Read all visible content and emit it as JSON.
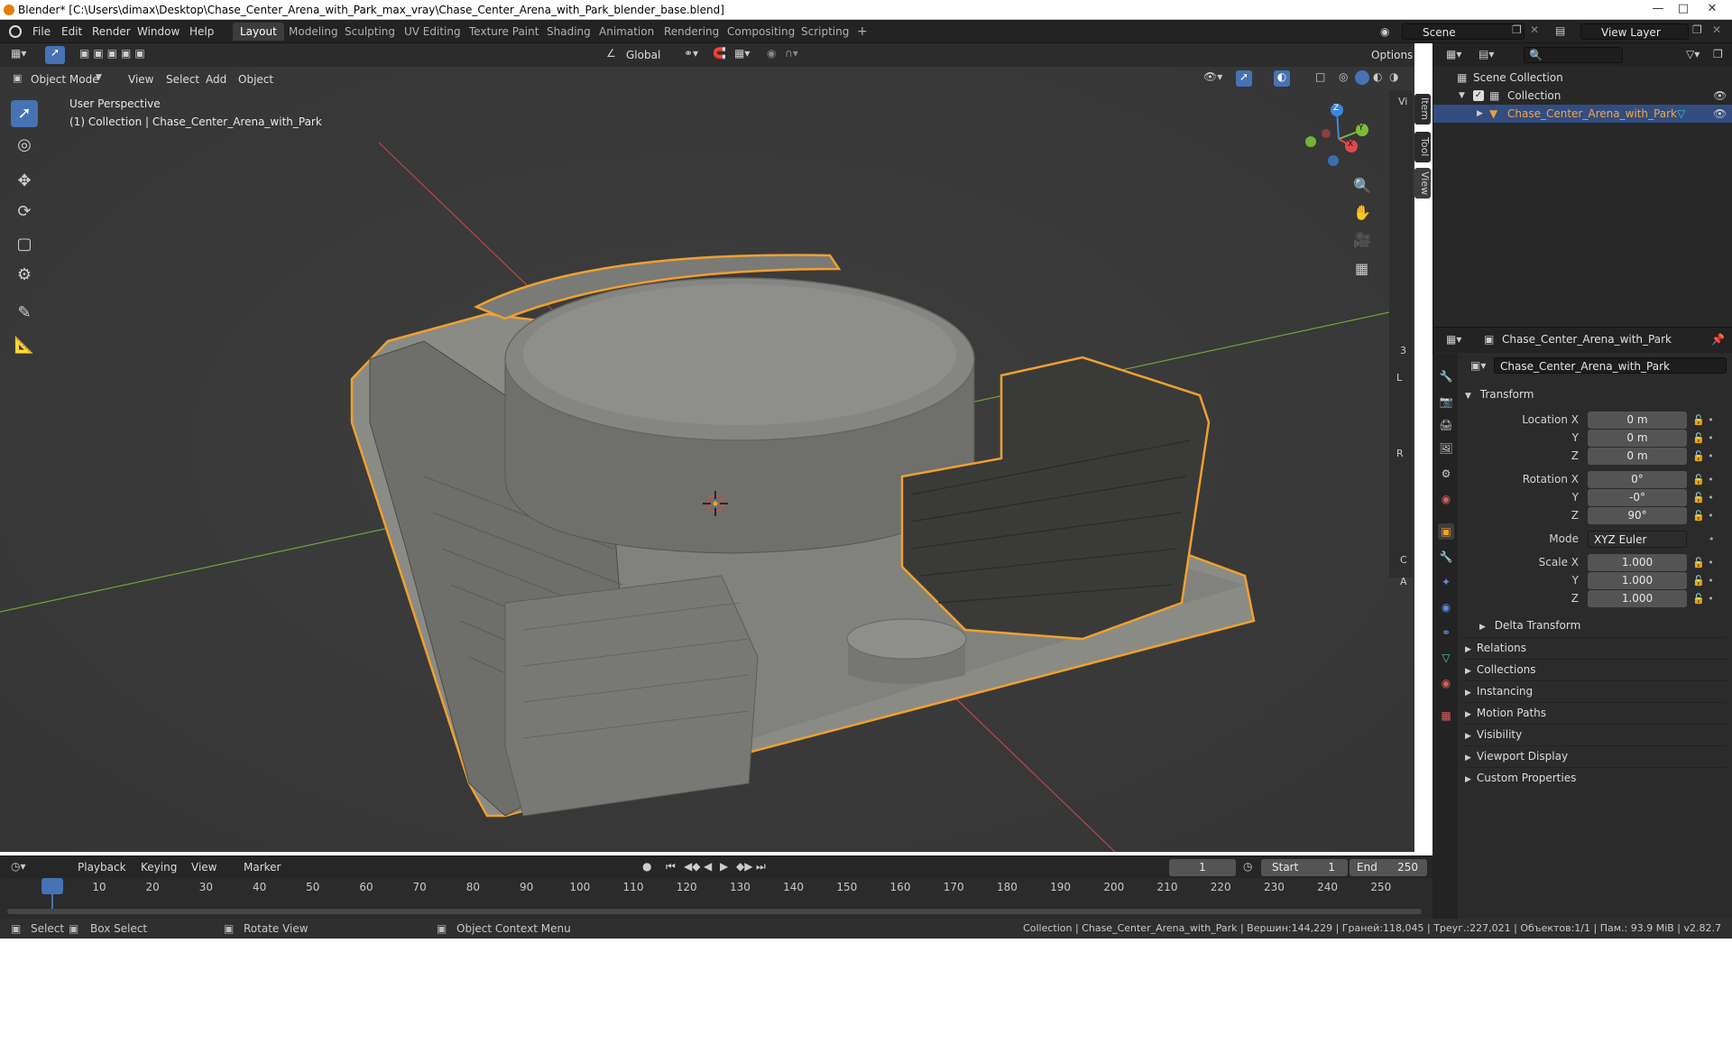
{
  "window": {
    "title": "Blender* [C:\\Users\\dimax\\Desktop\\Chase_Center_Arena_with_Park_max_vray\\Chase_Center_Arena_with_Park_blender_base.blend]"
  },
  "menu": [
    "File",
    "Edit",
    "Render",
    "Window",
    "Help"
  ],
  "workspaces": [
    "Layout",
    "Modeling",
    "Sculpting",
    "UV Editing",
    "Texture Paint",
    "Shading",
    "Animation",
    "Rendering",
    "Compositing",
    "Scripting"
  ],
  "active_workspace": "Layout",
  "scene": {
    "name": "Scene",
    "view_layer": "View Layer"
  },
  "viewport_header": {
    "orientation": "Global",
    "options": "Options",
    "mode": "Object Mode",
    "menus": [
      "View",
      "Select",
      "Add",
      "Object"
    ]
  },
  "viewport": {
    "perspective": "User Perspective",
    "collection_info": "(1) Collection | Chase_Center_Arena_with_Park",
    "npanel_tabs": [
      "Item",
      "Tool",
      "View"
    ],
    "gizmo": {
      "x": "X",
      "y": "Y",
      "z": "Z"
    },
    "side_labels": [
      "Vi",
      "3",
      "L",
      "R",
      "C",
      "A"
    ]
  },
  "outliner": {
    "root": "Scene Collection",
    "collection": "Collection",
    "object": "Chase_Center_Arena_with_Park"
  },
  "properties": {
    "object_name": "Chase_Center_Arena_with_Park",
    "data_name": "Chase_Center_Arena_with_Park",
    "transform_title": "Transform",
    "location": {
      "label": "Location X",
      "x": "0 m",
      "y": "0 m",
      "z": "0 m"
    },
    "rotation": {
      "label": "Rotation X",
      "x": "0°",
      "y": "-0°",
      "z": "90°"
    },
    "mode_label": "Mode",
    "mode_value": "XYZ Euler",
    "scale": {
      "label": "Scale X",
      "x": "1.000",
      "y": "1.000",
      "z": "1.000"
    },
    "axis_y": "Y",
    "axis_z": "Z",
    "delta_transform": "Delta Transform",
    "panels": [
      "Relations",
      "Collections",
      "Instancing",
      "Motion Paths",
      "Visibility",
      "Viewport Display",
      "Custom Properties"
    ]
  },
  "timeline": {
    "menus": [
      "Playback",
      "Keying",
      "View",
      "Marker"
    ],
    "current_frame": "1",
    "start_label": "Start",
    "start": "1",
    "end_label": "End",
    "end": "250",
    "ruler": [
      "1",
      "10",
      "20",
      "30",
      "40",
      "50",
      "60",
      "70",
      "80",
      "90",
      "100",
      "110",
      "120",
      "130",
      "140",
      "150",
      "160",
      "170",
      "180",
      "190",
      "200",
      "210",
      "220",
      "230",
      "240",
      "250"
    ]
  },
  "statusbar": {
    "select": "Select",
    "box_select": "Box Select",
    "rotate_view": "Rotate View",
    "context_menu": "Object Context Menu",
    "stats": "Collection | Chase_Center_Arena_with_Park | Вершин:144,229 | Граней:118,045 | Треуг.:227,021 | Объектов:1/1 | Пам.: 93.9 MiB | v2.82.7"
  },
  "colors": {
    "accent": "#4772b3",
    "selection_outline": "#f0a030",
    "x_axis": "#e04a4a",
    "y_axis": "#7cbe3a",
    "z_axis": "#3d86e0"
  }
}
